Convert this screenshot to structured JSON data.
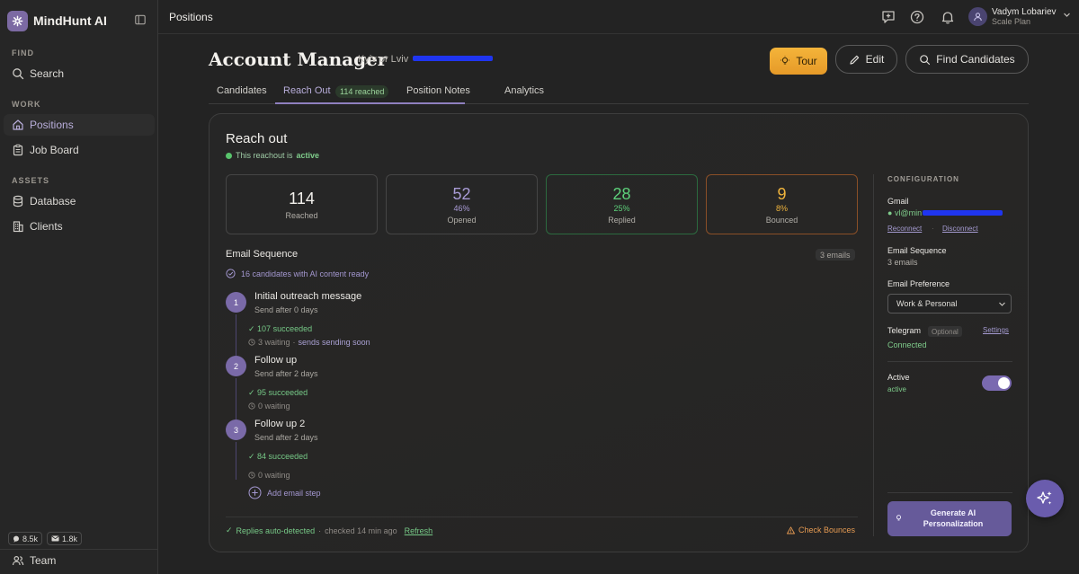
{
  "app": {
    "name": "MindHunt AI"
  },
  "sidebar": {
    "sections": [
      {
        "title": "FIND",
        "items": [
          {
            "label": "Search",
            "icon": "search-icon"
          }
        ]
      },
      {
        "title": "WORK",
        "items": [
          {
            "label": "Positions",
            "icon": "home-icon",
            "active": true
          },
          {
            "label": "Job Board",
            "icon": "clipboard-icon"
          }
        ]
      },
      {
        "title": "ASSETS",
        "items": [
          {
            "label": "Database",
            "icon": "database-icon"
          },
          {
            "label": "Clients",
            "icon": "building-icon"
          }
        ]
      }
    ],
    "counters": [
      {
        "value": "8.5k",
        "icon": "chat-icon"
      },
      {
        "value": "1.8k",
        "icon": "email-icon"
      }
    ],
    "team_label": "Team"
  },
  "topbar": {
    "breadcrumb": "Positions",
    "user": {
      "name": "Vadym Lobariev",
      "plan": "Scale Plan"
    }
  },
  "page": {
    "title": "Account Manager",
    "location": "Kyiv or Lviv",
    "buttons": {
      "tour": "Tour",
      "edit": "Edit",
      "find": "Find Candidates"
    },
    "tabs": [
      "Candidates",
      "Reach Out",
      "Position Notes",
      "Analytics"
    ],
    "active_tab": "Reach Out",
    "reach_badge": "114 reached"
  },
  "reachout": {
    "title": "Reach out",
    "status_prefix": "This reachout is",
    "status_value": "active",
    "stats": {
      "reached": {
        "value": "114",
        "label": "Reached"
      },
      "opened": {
        "value": "52",
        "pct": "46%",
        "label": "Opened",
        "color": "#a89bd6"
      },
      "replied": {
        "value": "28",
        "pct": "25%",
        "label": "Replied",
        "color": "#5dd07a"
      },
      "bounced": {
        "value": "9",
        "pct": "8%",
        "label": "Bounced",
        "color": "#f0b43c"
      }
    },
    "sequence_title": "Email Sequence",
    "sequence_count": "3 emails",
    "ai_ready": "16 candidates with AI content ready",
    "steps": [
      {
        "num": "1",
        "name": "Initial outreach message",
        "delay": "Send after 0 days",
        "succeeded": "107 succeeded",
        "waiting": "3 waiting",
        "waiting_note": "sends sending soon"
      },
      {
        "num": "2",
        "name": "Follow up",
        "delay": "Send after 2 days",
        "succeeded": "95 succeeded",
        "waiting": "0 waiting"
      },
      {
        "num": "3",
        "name": "Follow up 2",
        "delay": "Send after 2 days",
        "succeeded": "84 succeeded",
        "waiting": "0 waiting"
      }
    ],
    "add_step": "Add email step",
    "footer": {
      "replies": "Replies auto-detected",
      "checked": "checked 14 min ago",
      "refresh": "Refresh",
      "check_bounces": "Check Bounces"
    }
  },
  "config": {
    "title": "CONFIGURATION",
    "gmail_label": "Gmail",
    "gmail_value": "vl@min",
    "reconnect": "Reconnect",
    "disconnect": "Disconnect",
    "seq_label": "Email Sequence",
    "seq_value": "3 emails",
    "pref_label": "Email Preference",
    "pref_value": "Work & Personal",
    "telegram_label": "Telegram",
    "telegram_optional": "Optional",
    "telegram_settings": "Settings",
    "telegram_status": "Connected",
    "active_label": "Active",
    "active_value": "active",
    "generate_btn": "Generate AI Personalization"
  }
}
